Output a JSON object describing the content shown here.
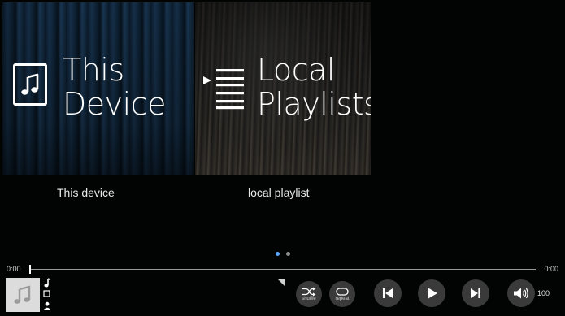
{
  "sources": [
    {
      "title_line1": "This",
      "title_line2": "Device",
      "caption": "This device",
      "icon": "music-note-icon"
    },
    {
      "title_line1": "Local",
      "title_line2": "Playlists",
      "caption": "local playlist",
      "icon": "playlist-icon"
    }
  ],
  "pager": {
    "pages": 2,
    "active": 1
  },
  "seek": {
    "elapsed": "0:00",
    "total": "0:00",
    "progress": 0
  },
  "controls": {
    "shuffle_label": "shuffle",
    "repeat_label": "repeat",
    "volume": "100"
  },
  "colors": {
    "accent_dot": "#5ba7ff",
    "button_bg": "#3a3a3a",
    "background": "#020303"
  }
}
